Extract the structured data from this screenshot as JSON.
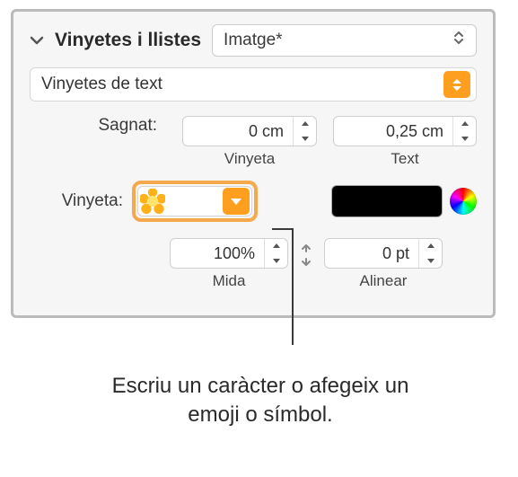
{
  "header": {
    "title": "Vinyetes i llistes",
    "style": "Imatge*"
  },
  "textBullets": {
    "label": "Vinyetes de text"
  },
  "indent": {
    "label": "Sagnat:",
    "bullet": {
      "value": "0 cm",
      "caption": "Vinyeta"
    },
    "text": {
      "value": "0,25 cm",
      "caption": "Text"
    }
  },
  "bullet": {
    "label": "Vinyeta:"
  },
  "size": {
    "value": "100%",
    "caption": "Mida"
  },
  "align": {
    "value": "0 pt",
    "caption": "Alinear"
  },
  "caption": "Escriu un caràcter o afegeix un emoji o símbol."
}
